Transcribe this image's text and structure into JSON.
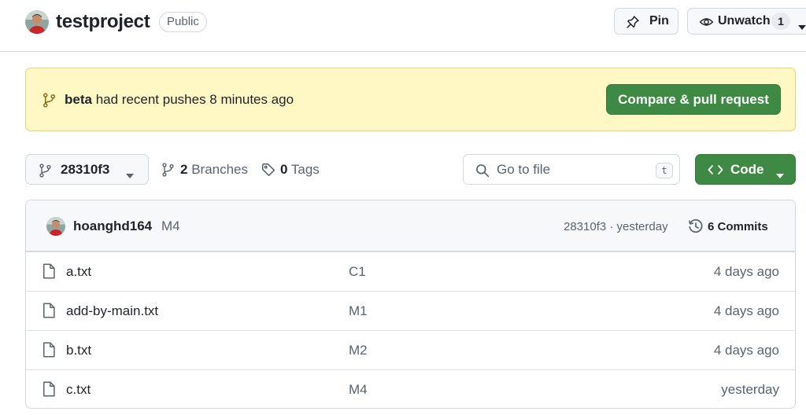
{
  "repo": {
    "name": "testproject",
    "visibility": "Public"
  },
  "header_actions": {
    "pin_label": "Pin",
    "watch_label": "Unwatch",
    "watch_count": "1"
  },
  "banner": {
    "branch": "beta",
    "message": " had recent pushes 8 minutes ago",
    "button_label": "Compare & pull request"
  },
  "toolbar": {
    "current_ref": "28310f3",
    "branches_count": "2",
    "branches_label": " Branches",
    "tags_count": "0",
    "tags_label": " Tags",
    "search_placeholder": "Go to file",
    "search_shortcut": "t",
    "code_label": "Code"
  },
  "latest_commit": {
    "author": "hoanghd164",
    "message": "M4",
    "meta": "28310f3 · yesterday",
    "commits_label": "6 Commits"
  },
  "files": [
    {
      "name": "a.txt",
      "commit": "C1",
      "time": "4 days ago"
    },
    {
      "name": "add-by-main.txt",
      "commit": "M1",
      "time": "4 days ago"
    },
    {
      "name": "b.txt",
      "commit": "M2",
      "time": "4 days ago"
    },
    {
      "name": "c.txt",
      "commit": "M4",
      "time": "yesterday"
    }
  ],
  "colors": {
    "accent_green": "#3e8a44",
    "banner_yellow": "#fff8c5",
    "border": "#d0d7de",
    "muted_text": "#59636e"
  },
  "icons": {
    "pin": "pin-icon",
    "watch": "eye-icon",
    "branch": "git-branch-icon",
    "tag": "tag-icon",
    "search": "search-icon",
    "code": "code-icon",
    "history": "history-icon",
    "file": "file-icon"
  }
}
